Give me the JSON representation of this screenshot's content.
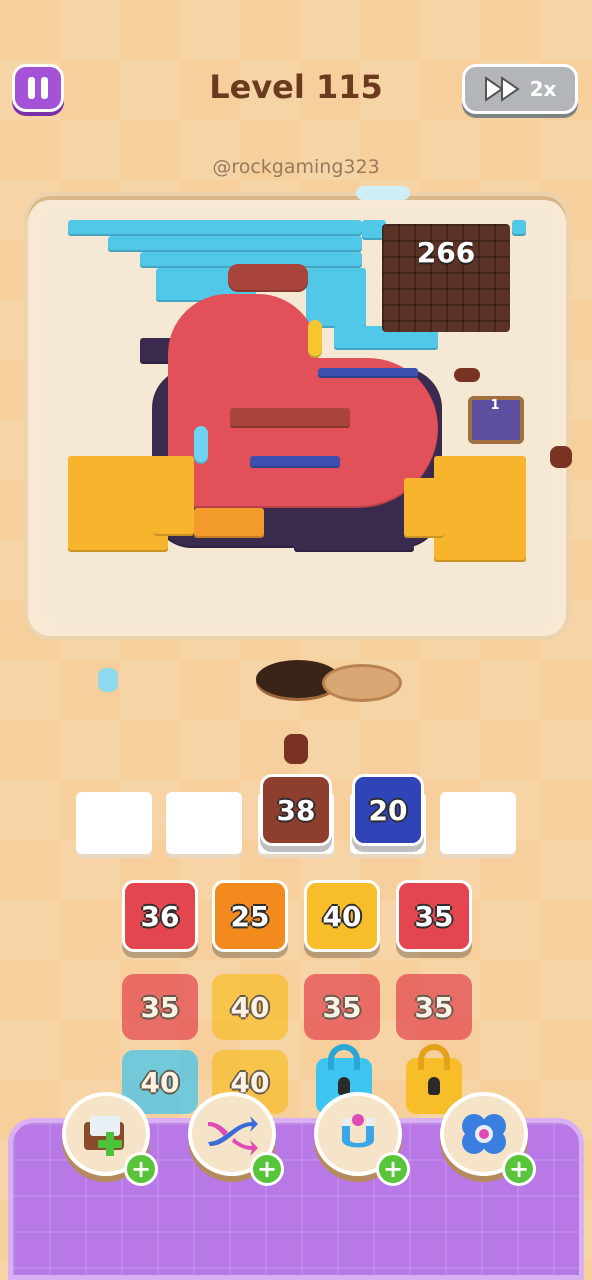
{
  "header": {
    "level_title": "Level 115",
    "speed_label": "2x",
    "watermark": "@rockgaming323"
  },
  "board": {
    "remaining_count": "266",
    "chest_count": "1"
  },
  "slots": [
    {
      "state": "empty"
    },
    {
      "state": "empty"
    },
    {
      "state": "filled",
      "value": "38",
      "color": "#8d3e2c"
    },
    {
      "state": "filled",
      "value": "20",
      "color": "#2f44b6"
    },
    {
      "state": "empty"
    }
  ],
  "grid": {
    "row1": [
      {
        "value": "36",
        "color": "#e3464f"
      },
      {
        "value": "25",
        "color": "#f28a1e"
      },
      {
        "value": "40",
        "color": "#f7be2a"
      },
      {
        "value": "35",
        "color": "#e3464f"
      }
    ],
    "row2": [
      {
        "value": "35",
        "color": "#e3464f"
      },
      {
        "value": "40",
        "color": "#f7be2a"
      },
      {
        "value": "35",
        "color": "#e3464f"
      },
      {
        "value": "35",
        "color": "#e3464f"
      }
    ],
    "row3": [
      {
        "value": "40",
        "color": "#3ec5ef"
      },
      {
        "value": "40",
        "color": "#f7be2a"
      },
      {
        "state": "locked",
        "color": "#3ec5ef"
      },
      {
        "state": "locked",
        "color": "#f7be2a"
      }
    ]
  },
  "boosters": [
    {
      "icon": "add-slot-icon"
    },
    {
      "icon": "shuffle-icon"
    },
    {
      "icon": "magnet-icon"
    },
    {
      "icon": "flower-icon"
    }
  ],
  "colors": {
    "accent_purple": "#a553d6",
    "level_text": "#6b3a1f",
    "tray": "#b879e6",
    "plus_green": "#57c43a"
  }
}
